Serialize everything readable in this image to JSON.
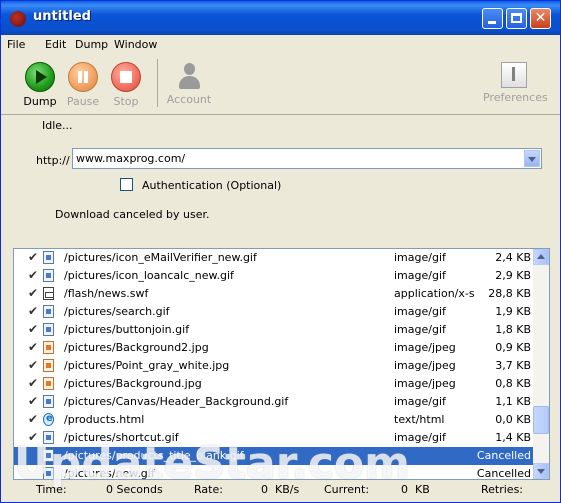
{
  "window": {
    "title": "untitled"
  },
  "menu": [
    "File",
    "Edit",
    "Dump",
    "Window"
  ],
  "toolbar": {
    "dump": "Dump",
    "pause": "Pause",
    "stop": "Stop",
    "account": "Account",
    "preferences": "Preferences"
  },
  "form": {
    "idle_text": "Idle...",
    "url_label": "http://",
    "url_value": "www.maxprog.com/",
    "auth_label": "Authentication (Optional)",
    "auth_checked": false,
    "status_message": "Download canceled by user."
  },
  "files": [
    {
      "check": "✔",
      "icon": "gif-file-icon",
      "path": "/pictures/icon_eMailVerifier_new.gif",
      "type": "image/gif",
      "size": "2,4 KB"
    },
    {
      "check": "✔",
      "icon": "gif-file-icon",
      "path": "/pictures/icon_loancalc_new.gif",
      "type": "image/gif",
      "size": "2,9 KB"
    },
    {
      "check": "✔",
      "icon": "swf-file-icon",
      "path": "/flash/news.swf",
      "type": "application/x-s...",
      "size": "28,8 KB"
    },
    {
      "check": "✔",
      "icon": "gif-file-icon",
      "path": "/pictures/search.gif",
      "type": "image/gif",
      "size": "1,9 KB"
    },
    {
      "check": "✔",
      "icon": "gif-file-icon",
      "path": "/pictures/buttonjoin.gif",
      "type": "image/gif",
      "size": "1,8 KB"
    },
    {
      "check": "✔",
      "icon": "jpg-file-icon",
      "path": "/pictures/Background2.jpg",
      "type": "image/jpeg",
      "size": "0,9 KB"
    },
    {
      "check": "✔",
      "icon": "jpg-file-icon",
      "path": "/pictures/Point_gray_white.jpg",
      "type": "image/jpeg",
      "size": "3,7 KB"
    },
    {
      "check": "✔",
      "icon": "jpg-file-icon",
      "path": "/pictures/Background.jpg",
      "type": "image/jpeg",
      "size": "0,8 KB"
    },
    {
      "check": "✔",
      "icon": "gif-file-icon",
      "path": "/pictures/Canvas/Header_Background.gif",
      "type": "image/gif",
      "size": "1,1 KB"
    },
    {
      "check": "✔",
      "icon": "html-file-icon",
      "path": "/products.html",
      "type": "text/html",
      "size": "0,0 KB"
    },
    {
      "check": "✔",
      "icon": "gif-file-icon",
      "path": "/pictures/shortcut.gif",
      "type": "image/gif",
      "size": "1,4 KB"
    },
    {
      "check": "",
      "icon": "gif-file-icon",
      "path": "/pictures/products_title_blank.gif",
      "type": "",
      "size": "Cancelled"
    },
    {
      "check": "",
      "icon": "gif-file-icon",
      "path": "/pictures/new.gif",
      "type": "",
      "size": "Cancelled"
    }
  ],
  "selected_row": 11,
  "statusbar": {
    "time_label": "Time:",
    "time_value": "0 Seconds",
    "rate_label": "Rate:",
    "rate_value": "0",
    "rate_unit": "KB/s",
    "current_label": "Current:",
    "current_value": "0",
    "current_unit": "KB",
    "retries_label": "Retries:"
  },
  "watermark": "UpdateStar.com",
  "colors": {
    "title_bar": "#0a55d8",
    "selection": "#316ac5",
    "window_bg": "#ece9d8"
  }
}
